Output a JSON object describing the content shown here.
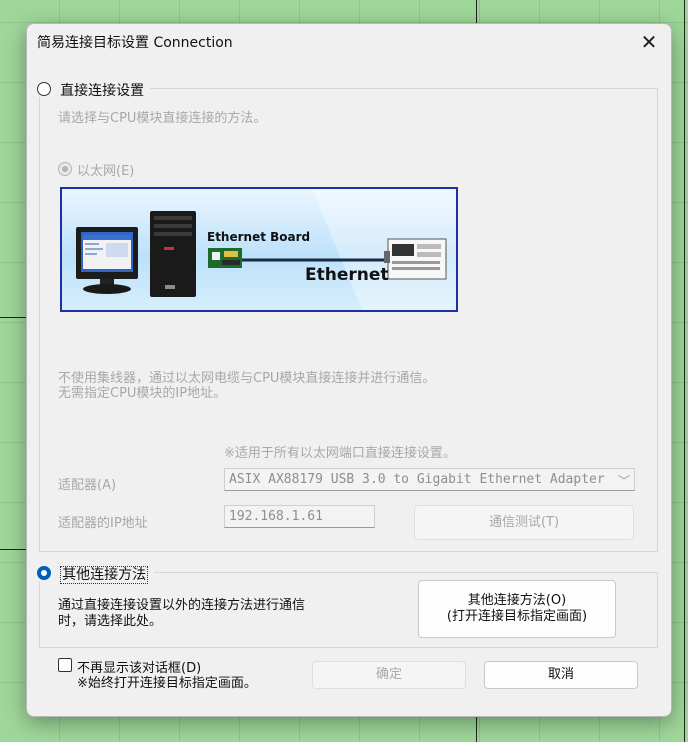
{
  "dialog": {
    "title": "简易连接目标设置 Connection",
    "close_glyph": "✕"
  },
  "direct": {
    "radio_label": "直接连接设置",
    "description": "请选择与CPU模块直接连接的方法。",
    "ethernet_option": "以太网(E)",
    "illustration": {
      "board_label": "Ethernet Board",
      "network_label": "Ethernet"
    },
    "info_line1": "不使用集线器，通过以太网电缆与CPU模块直接连接并进行通信。",
    "info_line2": "无需指定CPU模块的IP地址。",
    "note": "※适用于所有以太网端口直接连接设置。",
    "adapter_label": "适配器(A)",
    "adapter_value": "ASIX AX88179 USB 3.0 to Gigabit Ethernet Adapter",
    "ip_label": "适配器的IP地址",
    "ip_value": "192.168.1.61",
    "test_button": "通信测试(T)"
  },
  "other": {
    "radio_label": "其他连接方法",
    "description_line1": "通过直接连接设置以外的连接方法进行通信",
    "description_line2": "时，请选择此处。",
    "button_line1": "其他连接方法(O)",
    "button_line2": "(打开连接目标指定画面)"
  },
  "footer": {
    "checkbox_label": "不再显示该对话框(D)",
    "checkbox_note": "※始终打开连接目标指定画面。",
    "ok_button": "确定",
    "cancel_button": "取消"
  },
  "colors": {
    "accent": "#005fb8",
    "banner_border": "#1f2fa6",
    "background": "#9fd79a"
  }
}
